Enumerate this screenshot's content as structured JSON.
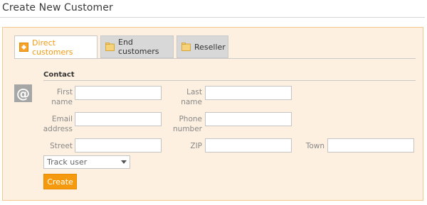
{
  "page": {
    "title": "Create New Customer"
  },
  "tabs": [
    {
      "label": "Direct customers",
      "icon": "diamond-icon",
      "active": true
    },
    {
      "label": "End customers",
      "icon": "folder-icon",
      "active": false
    },
    {
      "label": "Reseller",
      "icon": "folder-icon",
      "active": false
    }
  ],
  "section": {
    "label": "Contact",
    "icon": "at-icon"
  },
  "fields": {
    "first_name": {
      "label": "First\nname",
      "value": ""
    },
    "last_name": {
      "label": "Last\nname",
      "value": ""
    },
    "email": {
      "label": "Email\naddress",
      "value": ""
    },
    "phone": {
      "label": "Phone\nnumber",
      "value": ""
    },
    "street": {
      "label": "Street",
      "value": ""
    },
    "zip": {
      "label": "ZIP",
      "value": ""
    },
    "town": {
      "label": "Town",
      "value": ""
    }
  },
  "track_user": {
    "selected": "Track user"
  },
  "actions": {
    "create_label": "Create"
  },
  "colors": {
    "accent": "#f59a0e",
    "panel_bg": "#fdf0e0",
    "panel_border": "#f4c88a"
  }
}
